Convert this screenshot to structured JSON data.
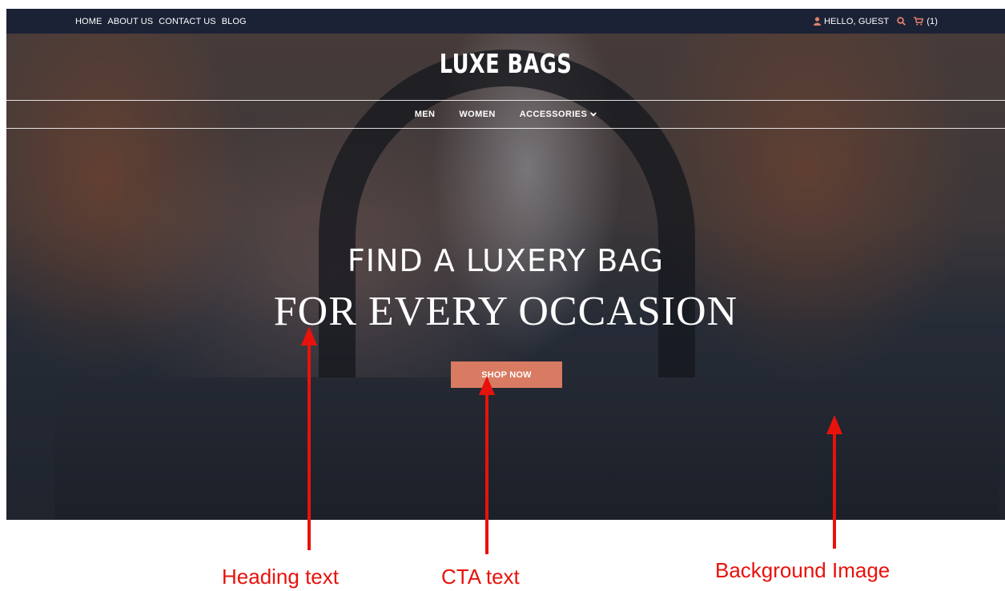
{
  "topbar": {
    "links": [
      "HOME",
      "ABOUT US",
      "CONTACT US",
      "BLOG"
    ],
    "greeting": "HELLO, GUEST",
    "cart_count": "(1)",
    "icons": {
      "user": "user-icon",
      "search": "search-icon",
      "cart": "cart-icon"
    },
    "accent_color": "#e0806b"
  },
  "header": {
    "brand": "LUXE BAGS",
    "nav": [
      "MEN",
      "WOMEN",
      "ACCESSORIES"
    ]
  },
  "hero": {
    "heading_line1": "FIND A LUXERY BAG",
    "heading_line2": "FOR EVERY OCCASION",
    "cta_label": "SHOP NOW",
    "cta_color": "#d97b62"
  },
  "annotations": {
    "heading": "Heading text",
    "cta": "CTA text",
    "background": "Background Image",
    "color": "#e8120c"
  }
}
